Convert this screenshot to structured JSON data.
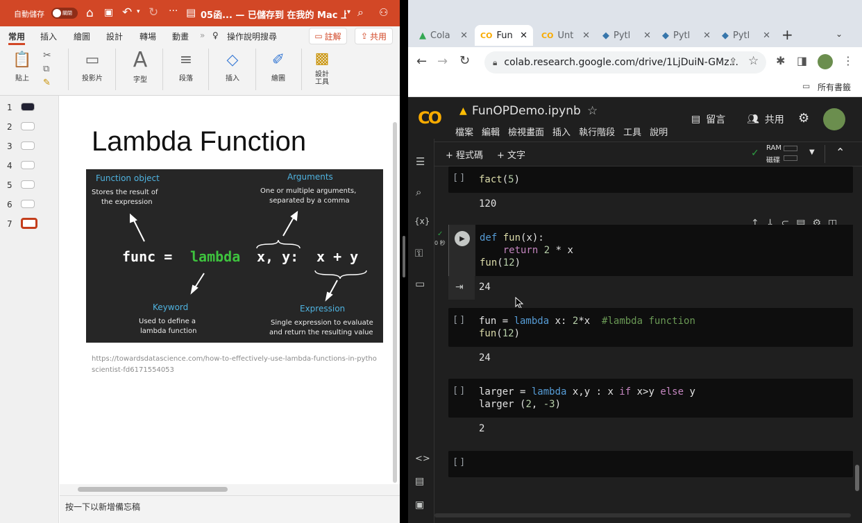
{
  "ppt": {
    "autosave_label": "自動儲存",
    "autosave_state": "關閉",
    "doc_title": "05函... — 已儲存到 在我的 Mac 上",
    "tabs": [
      "常用",
      "插入",
      "繪圖",
      "設計",
      "轉場",
      "動畫"
    ],
    "tell_me": "操作說明搜尋",
    "comments_label": "註解",
    "share_label": "共用",
    "ribbon": [
      {
        "icon": "paste-icon",
        "label": "貼上"
      },
      {
        "icon": "slide-layout-icon",
        "label": "投影片"
      },
      {
        "icon": "font-icon",
        "label": "字型"
      },
      {
        "icon": "paragraph-icon",
        "label": "段落"
      },
      {
        "icon": "insert-shape-icon",
        "label": "插入"
      },
      {
        "icon": "drawing-icon",
        "label": "繪圖"
      },
      {
        "icon": "designer-icon",
        "label": "設計\n工具"
      }
    ],
    "thumbnails": [
      "1",
      "2",
      "3",
      "4",
      "5",
      "6",
      "7"
    ],
    "slide": {
      "title": "Lambda Function",
      "figure": {
        "function_object_title": "Function object",
        "function_object_desc1": "Stores the result of",
        "function_object_desc2": "the expression",
        "arguments_title": "Arguments",
        "arguments_desc1": "One or multiple arguments,",
        "arguments_desc2": "separated by a comma",
        "code_func": "func =",
        "code_lambda": "lambda",
        "code_args": "x, y:",
        "code_expr": "x + y",
        "keyword_title": "Keyword",
        "keyword_desc1": "Used to define a",
        "keyword_desc2": "lambda function",
        "expression_title": "Expression",
        "expression_desc1": "Single expression to evaluate",
        "expression_desc2": "and return the resulting value"
      },
      "link_line1": "https://towardsdatascience.com/how-to-effectively-use-lambda-functions-in-pytho",
      "link_line2": "scientist-fd6171554053"
    },
    "notes_placeholder": "按一下以新增備忘稿"
  },
  "chrome": {
    "tabs": [
      {
        "icon": "google-drive-icon",
        "label": "Cola"
      },
      {
        "icon": "colab-icon",
        "label": "Fun"
      },
      {
        "icon": "colab-icon",
        "label": "Unt"
      },
      {
        "icon": "python-icon",
        "label": "Pytl"
      },
      {
        "icon": "python-icon",
        "label": "Pytl"
      },
      {
        "icon": "python-icon",
        "label": "Pytl"
      }
    ],
    "url": "colab.research.google.com/drive/1LjDuiN-GMz...",
    "bookmarks_label": "所有書籤"
  },
  "colab": {
    "notebook_name": "FunOPDemo.ipynb",
    "menu": [
      "檔案",
      "編輯",
      "檢視畫面",
      "插入",
      "執行階段",
      "工具",
      "說明"
    ],
    "comment_label": "留言",
    "share_label": "共用",
    "add_code": "+ 程式碼",
    "add_text": "+ 文字",
    "ram_label": "RAM",
    "disk_label": "磁碟",
    "exec_time": "0 秒",
    "cells": [
      {
        "bracket": "[ ]",
        "code": "fact(5)",
        "output": "120"
      },
      {
        "code": "def fun(x):\n    return 2 * x\nfun(12)",
        "output": "24"
      },
      {
        "bracket": "[ ]",
        "code": "fun = lambda x: 2*x  #lambda function\nfun(12)",
        "output": "24"
      },
      {
        "bracket": "[ ]",
        "code": "larger = lambda x,y : x if x>y else y\nlarger (2, -3)",
        "output": "2"
      },
      {
        "bracket": "[ ]",
        "code": ""
      }
    ]
  }
}
